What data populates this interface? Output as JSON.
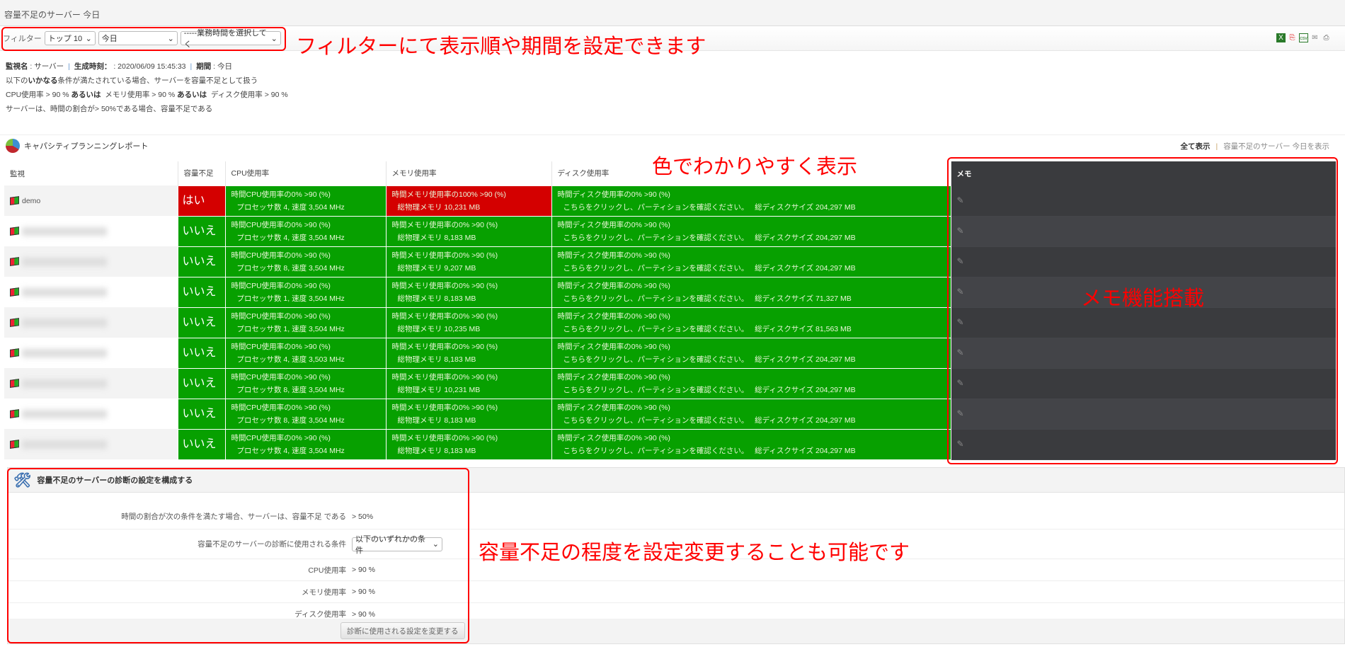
{
  "title": "容量不足のサーバー 今日",
  "filter": {
    "label": "フィルター",
    "top": "トップ 10",
    "period": "今日",
    "business_hours": "-----業務時間を選択してく"
  },
  "export_icons": [
    "excel-icon",
    "pdf-icon",
    "csv-icon",
    "mail-icon",
    "print-icon"
  ],
  "info": {
    "monitor_label": "監視名",
    "monitor": "サーバー",
    "generated_label": "生成時刻：",
    "generated": "2020/06/09 15:45:33",
    "period_label": "期間",
    "period": "今日",
    "line1_pre": "以下の",
    "line1_bold": "いかなる",
    "line1_post": "条件が満たされている場合、サーバーを容量不足として扱う",
    "cond_cpu": "CPU使用率 > 90 %",
    "or1": "あるいは",
    "cond_mem": "メモリ使用率 > 90 %",
    "or2": "あるいは",
    "cond_disk": "ディスク使用率 > 90 %",
    "line3": "サーバーは、時間の割合が> 50%である場合、容量不足である"
  },
  "report_title": "キャパシティプランニングレポート",
  "links": {
    "all": "全て表示",
    "filtered": "容量不足のサーバー 今日を表示"
  },
  "table": {
    "headers": [
      "監視",
      "容量不足",
      "CPU使用率",
      "メモリ使用率",
      "ディスク使用率",
      "メモ"
    ],
    "disk_link": "こちらをクリックし、パーティションを確認ください。",
    "rows": [
      {
        "name": "demo",
        "flag": "はい",
        "cpu1": "時間CPU使用率の0% >90 (%)",
        "cpu2": "プロセッサ数 4, 速度 3,504 MHz",
        "mem1": "時間メモリ使用率の100% >90 (%)",
        "mem2": "総物理メモリ 10,231 MB",
        "mem_alert": true,
        "disk1": "時間ディスク使用率の0% >90 (%)",
        "disk_size": "総ディスクサイズ 204,297 MB"
      },
      {
        "name": "",
        "flag": "いいえ",
        "cpu1": "時間CPU使用率の0% >90 (%)",
        "cpu2": "プロセッサ数 4, 速度 3,504 MHz",
        "mem1": "時間メモリ使用率の0% >90 (%)",
        "mem2": "総物理メモリ 8,183 MB",
        "disk1": "時間ディスク使用率の0% >90 (%)",
        "disk_size": "総ディスクサイズ 204,297 MB"
      },
      {
        "name": "",
        "flag": "いいえ",
        "cpu1": "時間CPU使用率の0% >90 (%)",
        "cpu2": "プロセッサ数 8, 速度 3,504 MHz",
        "mem1": "時間メモリ使用率の0% >90 (%)",
        "mem2": "総物理メモリ 9,207 MB",
        "disk1": "時間ディスク使用率の0% >90 (%)",
        "disk_size": "総ディスクサイズ 204,297 MB"
      },
      {
        "name": "",
        "flag": "いいえ",
        "cpu1": "時間CPU使用率の0% >90 (%)",
        "cpu2": "プロセッサ数 1, 速度 3,504 MHz",
        "mem1": "時間メモリ使用率の0% >90 (%)",
        "mem2": "総物理メモリ 8,183 MB",
        "disk1": "時間ディスク使用率の0% >90 (%)",
        "disk_size": "総ディスクサイズ 71,327 MB"
      },
      {
        "name": "",
        "flag": "いいえ",
        "cpu1": "時間CPU使用率の0% >90 (%)",
        "cpu2": "プロセッサ数 1, 速度 3,504 MHz",
        "mem1": "時間メモリ使用率の0% >90 (%)",
        "mem2": "総物理メモリ 10,235 MB",
        "disk1": "時間ディスク使用率の0% >90 (%)",
        "disk_size": "総ディスクサイズ 81,563 MB"
      },
      {
        "name": "",
        "flag": "いいえ",
        "cpu1": "時間CPU使用率の0% >90 (%)",
        "cpu2": "プロセッサ数 4, 速度 3,503 MHz",
        "mem1": "時間メモリ使用率の0% >90 (%)",
        "mem2": "総物理メモリ 8,183 MB",
        "disk1": "時間ディスク使用率の0% >90 (%)",
        "disk_size": "総ディスクサイズ 204,297 MB"
      },
      {
        "name": "",
        "flag": "いいえ",
        "cpu1": "時間CPU使用率の0% >90 (%)",
        "cpu2": "プロセッサ数 8, 速度 3,504 MHz",
        "mem1": "時間メモリ使用率の0% >90 (%)",
        "mem2": "総物理メモリ 10,231 MB",
        "disk1": "時間ディスク使用率の0% >90 (%)",
        "disk_size": "総ディスクサイズ 204,297 MB"
      },
      {
        "name": "",
        "flag": "いいえ",
        "cpu1": "時間CPU使用率の0% >90 (%)",
        "cpu2": "プロセッサ数 8, 速度 3,504 MHz",
        "mem1": "時間メモリ使用率の0% >90 (%)",
        "mem2": "総物理メモリ 8,183 MB",
        "disk1": "時間ディスク使用率の0% >90 (%)",
        "disk_size": "総ディスクサイズ 204,297 MB"
      },
      {
        "name": "",
        "flag": "いいえ",
        "cpu1": "時間CPU使用率の0% >90 (%)",
        "cpu2": "プロセッサ数 4, 速度 3,504 MHz",
        "mem1": "時間メモリ使用率の0% >90 (%)",
        "mem2": "総物理メモリ 8,183 MB",
        "disk1": "時間ディスク使用率の0% >90 (%)",
        "disk_size": "総ディスクサイズ 204,297 MB"
      }
    ]
  },
  "config": {
    "title": "容量不足のサーバーの診断の設定を構成する",
    "rows": [
      {
        "label": "時間の割合が次の条件を満たす場合、サーバーは、容量不足 である",
        "value": "> 50%"
      },
      {
        "label": "容量不足のサーバーの診断に使用される条件",
        "select": "以下のいずれかの条件"
      },
      {
        "label": "CPU使用率",
        "value": ">  90  %"
      },
      {
        "label": "メモリ使用率",
        "value": ">  90  %"
      },
      {
        "label": "ディスク使用率",
        "value": ">  90  %"
      }
    ],
    "button": "診断に使用される設定を変更する"
  },
  "annotations": {
    "filter": "フィルターにて表示順や期間を設定できます",
    "color": "色でわかりやすく表示",
    "memo": "メモ機能搭載",
    "config": "容量不足の程度を設定変更することも可能です"
  }
}
